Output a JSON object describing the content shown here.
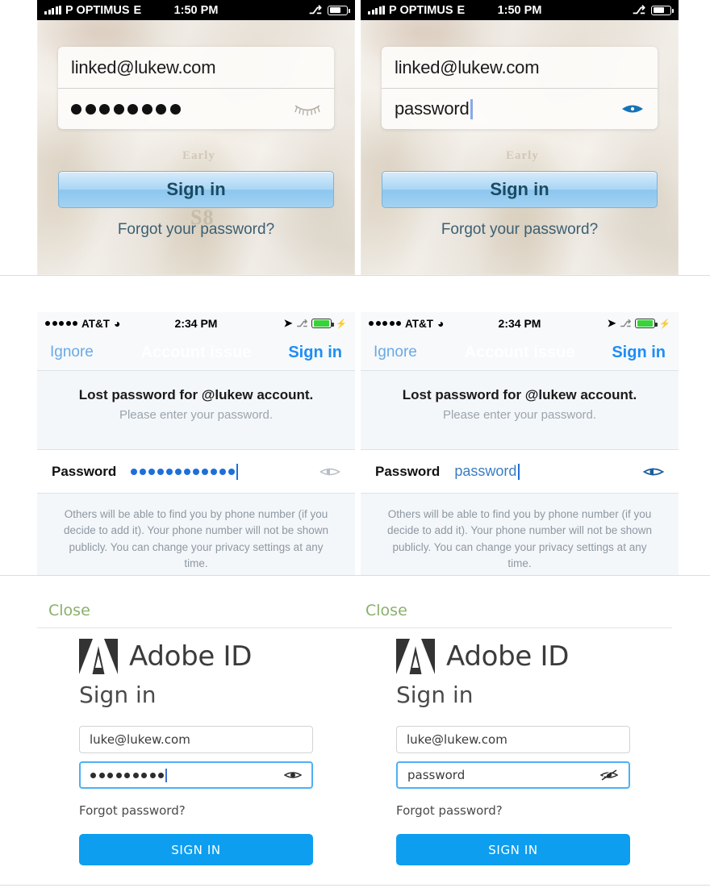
{
  "panels": {
    "linkedin_masked": {
      "status": {
        "carrier": "P OPTIMUS",
        "network": "E",
        "time": "1:50 PM",
        "bluetooth_icon": "bluetooth-icon",
        "battery_icon": "battery-icon",
        "signal_icon": "signal-bars-icon"
      },
      "email_value": "linked@lukew.com",
      "password_display": "●●●●●●●●",
      "password_dot_count": 8,
      "reveal_icon": "eye-closed-lashes-icon",
      "signin_label": "Sign in",
      "forgot_label": "Forgot your password?",
      "bg_ghost_1": "Early",
      "bg_ghost_2": "S8"
    },
    "linkedin_revealed": {
      "status": {
        "carrier": "P OPTIMUS",
        "network": "E",
        "time": "1:50 PM",
        "bluetooth_icon": "bluetooth-icon",
        "battery_icon": "battery-icon",
        "signal_icon": "signal-bars-icon"
      },
      "email_value": "linked@lukew.com",
      "password_display": "password",
      "reveal_icon": "eye-open-blue-icon",
      "signin_label": "Sign in",
      "forgot_label": "Forgot your password?",
      "bg_ghost_1": "Early"
    },
    "account_masked": {
      "status": {
        "carrier": "AT&T",
        "signal_pips": 5,
        "wifi_icon": "wifi-icon",
        "time": "2:34 PM",
        "location_icon": "location-arrow-icon",
        "bluetooth_icon": "bluetooth-icon",
        "battery_icon": "battery-charging-icon"
      },
      "nav_left": "Ignore",
      "nav_title": "Account issue",
      "nav_right": "Sign in",
      "message_title": "Lost password for @lukew account.",
      "message_sub": "Please enter your password.",
      "field_label": "Password",
      "password_display": "●●●●●●●●●●●●",
      "password_dot_count": 12,
      "reveal_icon": "eye-gray-icon",
      "note": "Others will be able to find you by phone number (if you decide to add it). Your phone number will not be shown publicly. You can change your privacy settings at any time."
    },
    "account_revealed": {
      "status": {
        "carrier": "AT&T",
        "signal_pips": 5,
        "wifi_icon": "wifi-icon",
        "time": "2:34 PM",
        "location_icon": "location-arrow-icon",
        "bluetooth_icon": "bluetooth-icon",
        "battery_icon": "battery-charging-icon"
      },
      "nav_left": "Ignore",
      "nav_title": "Account issue",
      "nav_right": "Sign in",
      "message_title": "Lost password for @lukew account.",
      "message_sub": "Please enter your password.",
      "field_label": "Password",
      "password_display": "password",
      "reveal_icon": "eye-blue-icon",
      "note": "Others will be able to find you by phone number (if you decide to add it). Your phone number will not be shown publicly. You can change your privacy settings at any time."
    },
    "adobe_masked": {
      "close_label": "Close",
      "brand": "Adobe ID",
      "logo_icon": "adobe-logo-icon",
      "title": "Sign in",
      "email_value": "luke@lukew.com",
      "password_display": "●●●●●●●●●",
      "password_dot_count": 9,
      "reveal_icon": "eye-open-icon",
      "forgot_label": "Forgot password?",
      "signin_label": "SIGN IN"
    },
    "adobe_revealed": {
      "close_label": "Close",
      "brand": "Adobe ID",
      "logo_icon": "adobe-logo-icon",
      "title": "Sign in",
      "email_value": "luke@lukew.com",
      "password_display": "password",
      "reveal_icon": "eye-slashed-icon",
      "forgot_label": "Forgot password?",
      "signin_label": "SIGN IN"
    }
  },
  "colors": {
    "linkedin_button_blue": "#a9d6f4",
    "ios_link_blue": "#1e8ef5",
    "adobe_blue": "#0d9ef0",
    "adobe_green": "#8ab06a",
    "battery_green": "#3ad23a",
    "focus_blue": "#4fb0f5"
  }
}
